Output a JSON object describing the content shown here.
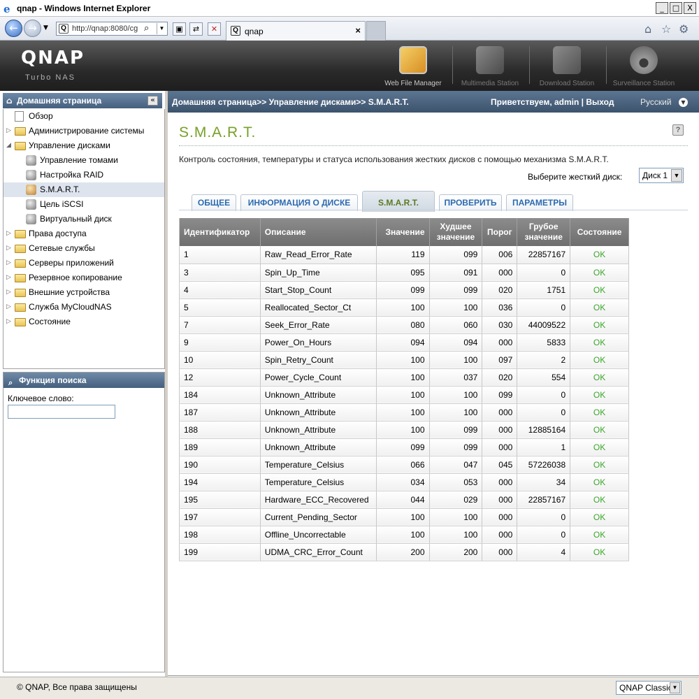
{
  "window": {
    "title": "qnap - Windows Internet Explorer",
    "min": "_",
    "max": "□",
    "close": "X"
  },
  "browser": {
    "url": "http://qnap:8080/cg",
    "tab_label": "qnap",
    "tab_close": "×",
    "favicon": "Q"
  },
  "header": {
    "logo": "QNAP",
    "subtitle": "Turbo NAS",
    "apps": [
      {
        "label": "Web File Manager"
      },
      {
        "label": "Multimedia Station"
      },
      {
        "label": "Download Station"
      },
      {
        "label": "Surveillance Station"
      }
    ]
  },
  "sidebar": {
    "home_title": "Домашняя страница",
    "collapse": "«",
    "tree": [
      {
        "label": "Обзор"
      },
      {
        "label": "Администрирование системы"
      },
      {
        "label": "Управление дисками"
      },
      {
        "label": "Управление томами"
      },
      {
        "label": "Настройка RAID"
      },
      {
        "label": "S.M.A.R.T."
      },
      {
        "label": "Цель iSCSI"
      },
      {
        "label": "Виртуальный диск"
      },
      {
        "label": "Права доступа"
      },
      {
        "label": "Сетевые службы"
      },
      {
        "label": "Серверы приложений"
      },
      {
        "label": "Резервное копирование"
      },
      {
        "label": "Внешние устройства"
      },
      {
        "label": "Служба MyCloudNAS"
      },
      {
        "label": "Состояние"
      }
    ],
    "search": {
      "title": "Функция поиска",
      "keyword_label": "Ключевое слово:",
      "keyword_value": ""
    }
  },
  "main": {
    "breadcrumb": "Домашняя страница>> Управление дисками>> S.M.A.R.T.",
    "welcome": "Приветствуем, admin | Выход",
    "language": "Русский",
    "page_title": "S.M.A.R.T.",
    "help": "?",
    "description": "Контроль состояния, температуры и статуса использования жестких дисков с помощью механизма S.M.A.R.T.",
    "disk_label": "Выберите жесткий диск:",
    "disk_value": "Диск 1",
    "tabs": [
      {
        "label": "ОБЩЕЕ"
      },
      {
        "label": "ИНФОРМАЦИЯ О ДИСКЕ"
      },
      {
        "label": "S.M.A.R.T."
      },
      {
        "label": "ПРОВЕРИТЬ"
      },
      {
        "label": "ПАРАМЕТРЫ"
      }
    ],
    "table": {
      "headers": [
        "Идентификатор",
        "Описание",
        "Значение",
        "Худшее значение",
        "Порог",
        "Грубое значение",
        "Состояние"
      ],
      "rows": [
        [
          "1",
          "Raw_Read_Error_Rate",
          "119",
          "099",
          "006",
          "22857167",
          "OK"
        ],
        [
          "3",
          "Spin_Up_Time",
          "095",
          "091",
          "000",
          "0",
          "OK"
        ],
        [
          "4",
          "Start_Stop_Count",
          "099",
          "099",
          "020",
          "1751",
          "OK"
        ],
        [
          "5",
          "Reallocated_Sector_Ct",
          "100",
          "100",
          "036",
          "0",
          "OK"
        ],
        [
          "7",
          "Seek_Error_Rate",
          "080",
          "060",
          "030",
          "44009522",
          "OK"
        ],
        [
          "9",
          "Power_On_Hours",
          "094",
          "094",
          "000",
          "5833",
          "OK"
        ],
        [
          "10",
          "Spin_Retry_Count",
          "100",
          "100",
          "097",
          "2",
          "OK"
        ],
        [
          "12",
          "Power_Cycle_Count",
          "100",
          "037",
          "020",
          "554",
          "OK"
        ],
        [
          "184",
          "Unknown_Attribute",
          "100",
          "100",
          "099",
          "0",
          "OK"
        ],
        [
          "187",
          "Unknown_Attribute",
          "100",
          "100",
          "000",
          "0",
          "OK"
        ],
        [
          "188",
          "Unknown_Attribute",
          "100",
          "099",
          "000",
          "12885164",
          "OK"
        ],
        [
          "189",
          "Unknown_Attribute",
          "099",
          "099",
          "000",
          "1",
          "OK"
        ],
        [
          "190",
          "Temperature_Celsius",
          "066",
          "047",
          "045",
          "57226038",
          "OK"
        ],
        [
          "194",
          "Temperature_Celsius",
          "034",
          "053",
          "000",
          "34",
          "OK"
        ],
        [
          "195",
          "Hardware_ECC_Recovered",
          "044",
          "029",
          "000",
          "22857167",
          "OK"
        ],
        [
          "197",
          "Current_Pending_Sector",
          "100",
          "100",
          "000",
          "0",
          "OK"
        ],
        [
          "198",
          "Offline_Uncorrectable",
          "100",
          "100",
          "000",
          "0",
          "OK"
        ],
        [
          "199",
          "UDMA_CRC_Error_Count",
          "200",
          "200",
          "000",
          "4",
          "OK"
        ]
      ]
    }
  },
  "footer": {
    "copyright": "© QNAP, Все права защищены",
    "theme": "QNAP Classic"
  },
  "colors": {
    "title_green": "#78a026",
    "tab_blue": "#2c6ab0",
    "ok_green": "#3aa62a"
  }
}
